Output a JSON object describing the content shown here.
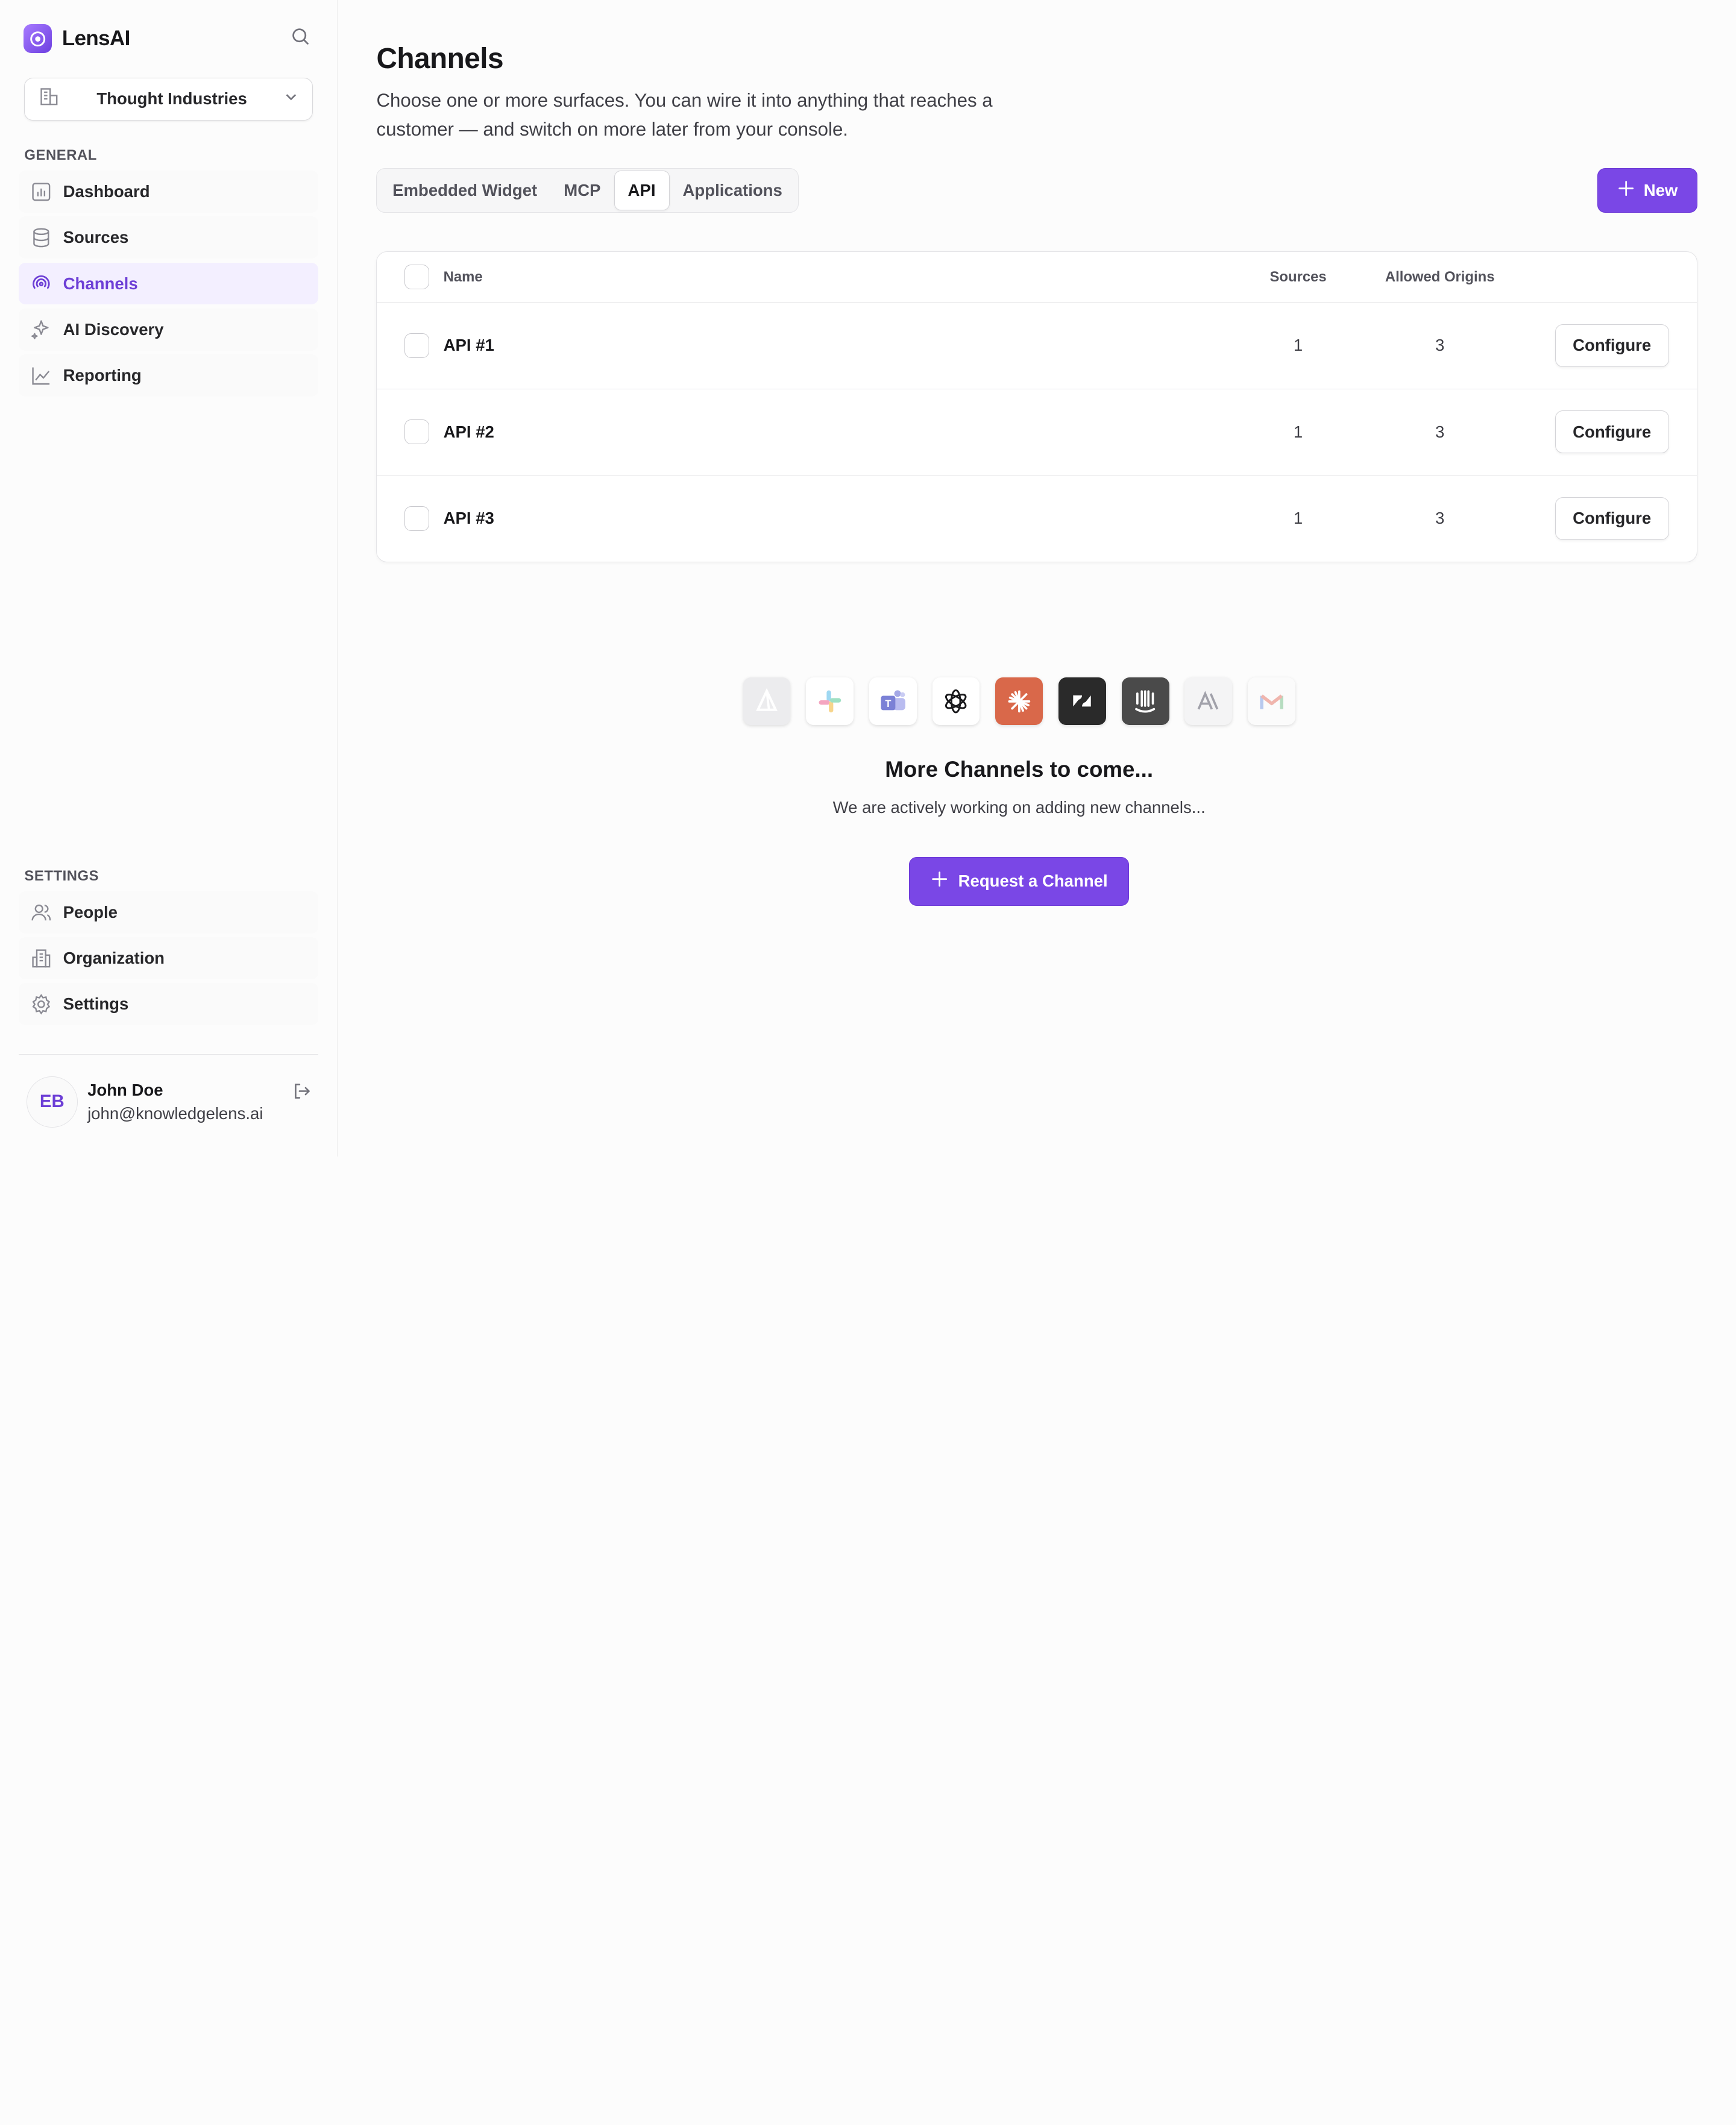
{
  "app": {
    "name": "LensAI"
  },
  "org_selector": {
    "value": "Thought Industries"
  },
  "sidebar": {
    "general_label": "GENERAL",
    "general_items": [
      {
        "label": "Dashboard",
        "icon": "chart-icon"
      },
      {
        "label": "Sources",
        "icon": "database-icon"
      },
      {
        "label": "Channels",
        "icon": "broadcast-icon",
        "active": true
      },
      {
        "label": "AI Discovery",
        "icon": "sparkles-icon"
      },
      {
        "label": "Reporting",
        "icon": "line-chart-icon"
      }
    ],
    "settings_label": "SETTINGS",
    "settings_items": [
      {
        "label": "People",
        "icon": "users-icon"
      },
      {
        "label": "Organization",
        "icon": "building-icon"
      },
      {
        "label": "Settings",
        "icon": "gear-icon"
      }
    ]
  },
  "user": {
    "initials": "EB",
    "name": "John Doe",
    "email": "john@knowledgelens.ai"
  },
  "page": {
    "title": "Channels",
    "description": "Choose one or more surfaces. You can wire it into anything that reaches a customer — and switch on more later from your console."
  },
  "tabs": [
    {
      "label": "Embedded Widget"
    },
    {
      "label": "MCP"
    },
    {
      "label": "API",
      "active": true
    },
    {
      "label": "Applications"
    }
  ],
  "new_button": {
    "label": "New"
  },
  "table": {
    "columns": {
      "name": "Name",
      "sources": "Sources",
      "origins": "Allowed Origins"
    },
    "rows": [
      {
        "name": "API #1",
        "sources": "1",
        "origins": "3",
        "action": "Configure"
      },
      {
        "name": "API #2",
        "sources": "1",
        "origins": "3",
        "action": "Configure"
      },
      {
        "name": "API #3",
        "sources": "1",
        "origins": "3",
        "action": "Configure"
      }
    ]
  },
  "more_channels": {
    "title": "More Channels to come...",
    "subtitle": "We are actively working on adding new channels...",
    "button": "Request a Channel",
    "logos": [
      "delta-logo-icon",
      "slack-icon",
      "teams-icon",
      "openai-icon",
      "claude-icon",
      "zendesk-icon",
      "intercom-icon",
      "anthropic-icon",
      "gmail-icon"
    ]
  },
  "colors": {
    "accent": "#7a47e6",
    "active_bg": "#f3efff",
    "active_text": "#6d3fd6"
  }
}
